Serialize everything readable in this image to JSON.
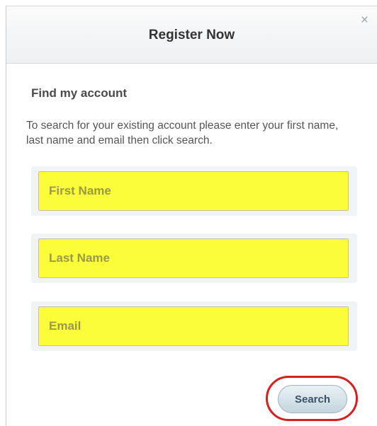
{
  "dialog": {
    "title": "Register Now",
    "close_label": "×"
  },
  "section": {
    "title": "Find my account",
    "instructions": "To search for your existing account please enter your first name, last name and email then click search."
  },
  "form": {
    "first_name": {
      "placeholder": "First Name",
      "value": ""
    },
    "last_name": {
      "placeholder": "Last Name",
      "value": ""
    },
    "email": {
      "placeholder": "Email",
      "value": ""
    },
    "search_label": "Search"
  },
  "colors": {
    "field_highlight": "#fbfc3a",
    "annotation_circle": "#d42020"
  }
}
